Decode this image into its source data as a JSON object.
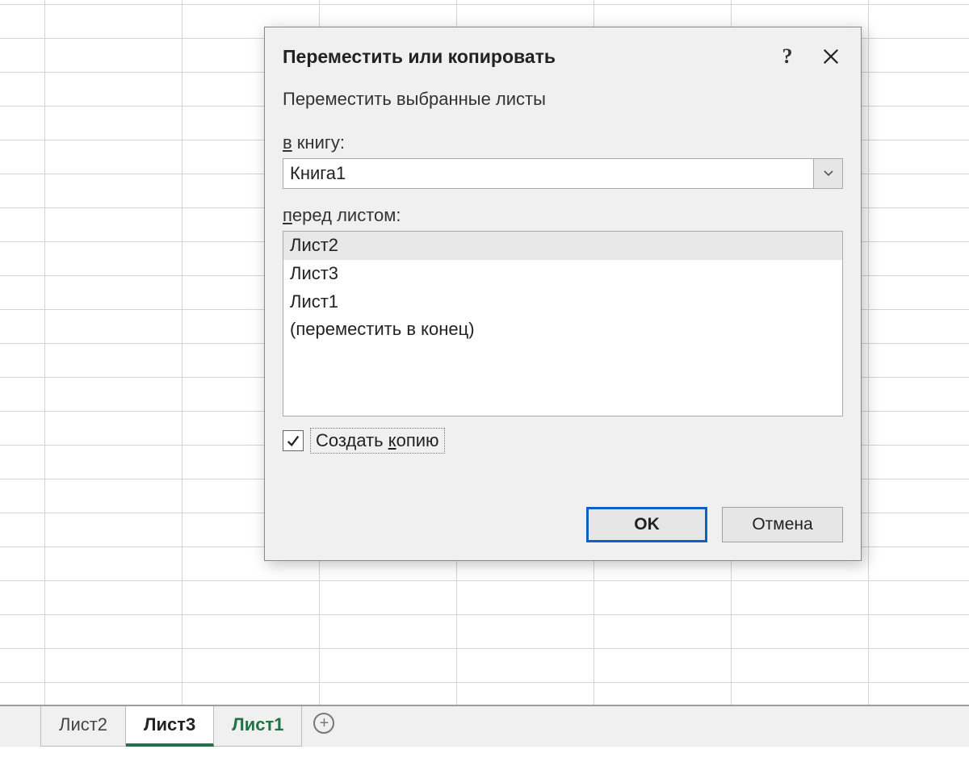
{
  "dialog": {
    "title": "Переместить или копировать",
    "subtitle": "Переместить выбранные листы",
    "to_book_label_prefix_ul": "в",
    "to_book_label_rest": " книгу:",
    "to_book_value": "Книга1",
    "before_sheet_label_prefix_ul": "п",
    "before_sheet_label_rest": "еред листом:",
    "sheet_options": [
      "Лист2",
      "Лист3",
      "Лист1",
      "(переместить в конец)"
    ],
    "selected_index": 0,
    "create_copy_label_pre": "Создать ",
    "create_copy_label_ul": "к",
    "create_copy_label_post": "опию",
    "create_copy_checked": true,
    "ok_label": "OK",
    "cancel_label": "Отмена"
  },
  "tabs": {
    "items": [
      {
        "label": "Лист2"
      },
      {
        "label": "Лист3"
      },
      {
        "label": "Лист1"
      }
    ],
    "active_index": 1,
    "green_index": 2
  },
  "icons": {
    "help": "?",
    "plus": "+"
  }
}
